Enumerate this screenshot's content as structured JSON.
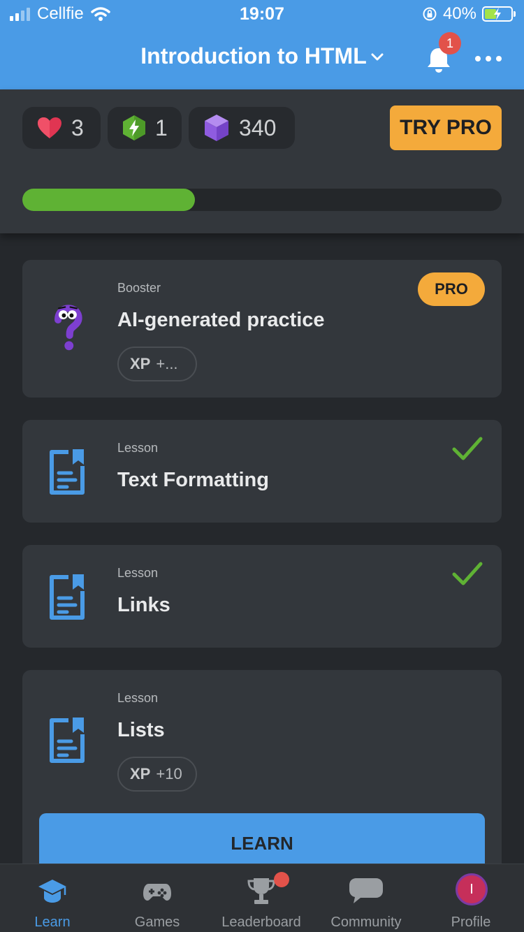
{
  "status_bar": {
    "carrier": "Cellfie",
    "time": "19:07",
    "battery": "40%"
  },
  "header": {
    "title": "Introduction to HTML",
    "notifications_count": "1"
  },
  "stats": {
    "hearts": "3",
    "streak": "1",
    "gems": "340",
    "try_pro_label": "TRY PRO",
    "progress_fraction": 0.36
  },
  "cards": [
    {
      "type": "Booster",
      "title": "AI-generated practice",
      "badge": "PRO",
      "xp_label": "XP",
      "xp_value": "+...",
      "icon": "question-mascot-icon"
    },
    {
      "type": "Lesson",
      "title": "Text Formatting",
      "completed": true,
      "icon": "lesson-document-icon"
    },
    {
      "type": "Lesson",
      "title": "Links",
      "completed": true,
      "icon": "lesson-document-icon"
    },
    {
      "type": "Lesson",
      "title": "Lists",
      "xp_label": "XP",
      "xp_value": "+10",
      "icon": "lesson-document-icon",
      "action_label": "LEARN"
    }
  ],
  "tabs": [
    {
      "label": "Learn",
      "icon": "graduation-cap-icon",
      "active": true
    },
    {
      "label": "Games",
      "icon": "gamepad-icon"
    },
    {
      "label": "Leaderboard",
      "icon": "trophy-icon"
    },
    {
      "label": "Community",
      "icon": "chat-bubble-icon"
    },
    {
      "label": "Profile",
      "icon": "avatar",
      "avatar_initial": "I"
    }
  ],
  "colors": {
    "accent": "#4a9be6",
    "pro": "#f4aa3b",
    "success": "#5fb234",
    "card_bg": "#33373c",
    "page_bg": "#25282c"
  }
}
